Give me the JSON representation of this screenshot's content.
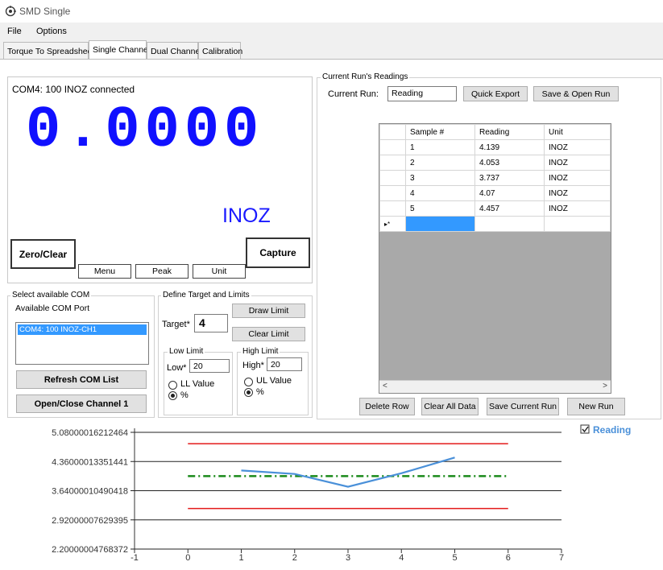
{
  "window": {
    "title": "SMD Single"
  },
  "menu": {
    "file": "File",
    "options": "Options"
  },
  "tabs": [
    "Torque To Spreadsheet",
    "Single Channel",
    "Dual Channel",
    "Calibration"
  ],
  "display": {
    "status": "COM4: 100 INOZ connected",
    "value": "0.0000",
    "unit": "INOZ",
    "zero_clear": "Zero/Clear",
    "capture": "Capture",
    "menu": "Menu",
    "peak": "Peak",
    "unit_button": "Unit",
    "value_color": "#1010ff",
    "unit_color": "#1a1aff"
  },
  "com": {
    "group_label": "Select available COM",
    "port_label": "Available COM Port",
    "ports": [
      "COM4: 100 INOZ-CH1"
    ],
    "refresh": "Refresh COM List",
    "open_close": "Open/Close Channel 1"
  },
  "target": {
    "group_label": "Define Target and Limits",
    "target_label": "Target*",
    "target_value": "4",
    "draw_limit": "Draw Limit",
    "clear_limit": "Clear Limit",
    "low": {
      "label": "Low Limit",
      "field_label": "Low*",
      "value": "20",
      "opt_value": "LL Value",
      "opt_pct": "%",
      "selected": "%"
    },
    "high": {
      "label": "High Limit",
      "field_label": "High*",
      "value": "20",
      "opt_value": "UL Value",
      "opt_pct": "%",
      "selected": "%"
    }
  },
  "run": {
    "group_label": "Current Run's Readings",
    "current_label": "Current Run:",
    "current_value": "Reading",
    "quick_export": "Quick Export",
    "save_open": "Save & Open Run",
    "columns": [
      "Sample #",
      "Reading",
      "Unit"
    ],
    "rows": [
      [
        "1",
        "4.139",
        "INOZ"
      ],
      [
        "2",
        "4.053",
        "INOZ"
      ],
      [
        "3",
        "3.737",
        "INOZ"
      ],
      [
        "4",
        "4.07",
        "INOZ"
      ],
      [
        "5",
        "4.457",
        "INOZ"
      ]
    ],
    "new_row_marker": "▸*",
    "delete_row": "Delete Row",
    "clear_all": "Clear All Data",
    "save_current": "Save Current Run",
    "new_run": "New Run"
  },
  "chart_data": {
    "type": "line",
    "legend": {
      "label": "Reading",
      "checked": true,
      "placement": "top-right",
      "color": "#4a90d9"
    },
    "xlim": [
      -1,
      7
    ],
    "ylim": [
      2.20000004768372,
      5.08000016212464
    ],
    "x_ticks": [
      "-1",
      "0",
      "1",
      "2",
      "3",
      "4",
      "5",
      "6",
      "7"
    ],
    "y_ticks": [
      "5.08000016212464",
      "4.36000013351441",
      "3.64000010490418",
      "2.92000007629395",
      "2.20000004768372"
    ],
    "y_tick_values": [
      5.08000016212464,
      4.36000013351441,
      3.64000010490418,
      2.92000007629395,
      2.20000004768372
    ],
    "series": [
      {
        "name": "Reading",
        "x": [
          1,
          2,
          3,
          4,
          5
        ],
        "values": [
          4.139,
          4.053,
          3.737,
          4.07,
          4.457
        ],
        "color": "#4a90d9"
      }
    ],
    "limits": {
      "upper": {
        "value": 4.8,
        "x": [
          0,
          6
        ],
        "color": "#e31a1a"
      },
      "target": {
        "value": 4,
        "x": [
          0,
          6
        ],
        "color": "#1a8a1a"
      },
      "lower": {
        "value": 3.2,
        "x": [
          0,
          6
        ],
        "color": "#e31a1a"
      }
    },
    "grid": "horizontal"
  }
}
